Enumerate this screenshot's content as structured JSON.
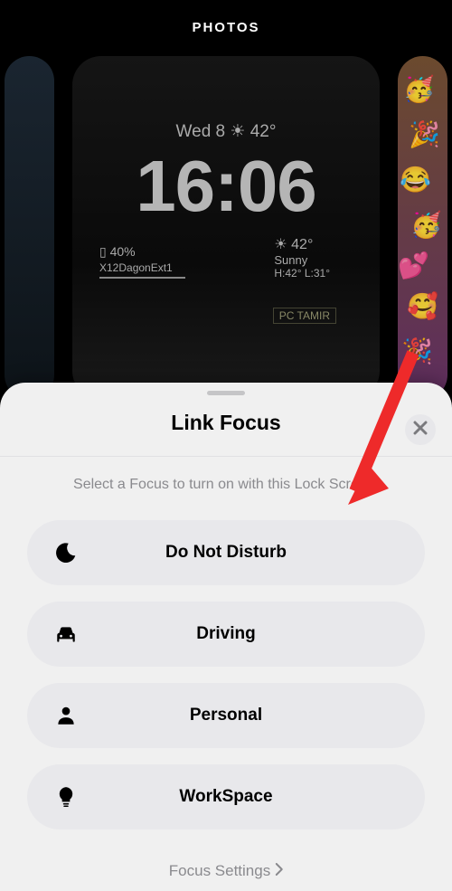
{
  "header": {
    "photos_label": "PHOTOS"
  },
  "lockscreen": {
    "date_line": "Wed 8  ☀  42°",
    "time": "16:06",
    "battery": "▯  40%",
    "wifi": "X12DagonExt1",
    "weather": {
      "line1": "☀  42°",
      "line2": "Sunny",
      "line3": "H:42° L:31°"
    },
    "sign": "PC TAMIR"
  },
  "sheet": {
    "title": "Link Focus",
    "subtitle": "Select a Focus to turn on with this Lock Screen.",
    "items": [
      {
        "label": "Do Not Disturb",
        "icon": "moon"
      },
      {
        "label": "Driving",
        "icon": "car"
      },
      {
        "label": "Personal",
        "icon": "person"
      },
      {
        "label": "WorkSpace",
        "icon": "bulb"
      }
    ],
    "footer": "Focus Settings"
  }
}
